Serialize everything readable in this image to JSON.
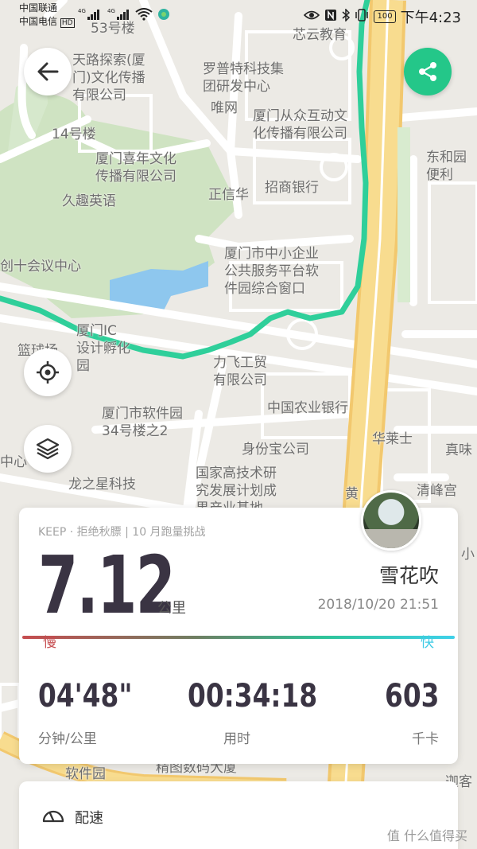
{
  "status_bar": {
    "carrier1": "中国联通",
    "carrier2": "中国电信",
    "hd": "HD",
    "net": "4G",
    "battery": "100",
    "time": "下午4:23"
  },
  "map": {
    "labels": [
      {
        "text": "53号楼"
      },
      {
        "text": "芯云教育"
      },
      {
        "text": "天路探索(厦\n门)文化传播\n有限公司"
      },
      {
        "text": "罗普特科技集\n团研发中心"
      },
      {
        "text": "唯网"
      },
      {
        "text": "厦门从众互动文\n化传播有限公司"
      },
      {
        "text": "14号楼"
      },
      {
        "text": "东和园\n便利"
      },
      {
        "text": "厦门喜年文化\n传播有限公司"
      },
      {
        "text": "正信华"
      },
      {
        "text": "招商银行"
      },
      {
        "text": "久趣英语"
      },
      {
        "text": "厦门市中小企业\n公共服务平台软\n件园综合窗口"
      },
      {
        "text": "创十会议中心"
      },
      {
        "text": "厦门IC\n设计孵化\n园"
      },
      {
        "text": "篮球场"
      },
      {
        "text": "力飞工贸\n有限公司"
      },
      {
        "text": "中国农业银行"
      },
      {
        "text": "厦门市软件园\n34号楼之2"
      },
      {
        "text": "华莱士"
      },
      {
        "text": "真味"
      },
      {
        "text": "中心"
      },
      {
        "text": "身份宝公司"
      },
      {
        "text": "国家高技术研\n究发展计划成\n果产业基地"
      },
      {
        "text": "龙之星科技"
      },
      {
        "text": "黄"
      },
      {
        "text": "清峰宫"
      },
      {
        "text": "小"
      },
      {
        "text": "软件园"
      },
      {
        "text": "精图数码大厦"
      },
      {
        "text": "迦客"
      }
    ]
  },
  "card": {
    "tag": "KEEP · 拒绝秋膘 | 10 月跑量挑战",
    "distance": "7.12",
    "unit": "公里",
    "username": "雪花吹",
    "date": "2018/10/20 21:51",
    "slow": "慢",
    "fast": "快",
    "stats": [
      {
        "value": "04'48\"",
        "label": "分钟/公里"
      },
      {
        "value": "00:34:18",
        "label": "用时"
      },
      {
        "value": "603",
        "label": "千卡"
      }
    ]
  },
  "pace": {
    "label": "配速"
  },
  "watermark": "值 什么值得买",
  "colors": {
    "route": "#2fcf9a",
    "share_button": "#24c789",
    "slow": "#c64d50",
    "fast": "#3fd1ea",
    "primary_text": "#3a3443"
  }
}
